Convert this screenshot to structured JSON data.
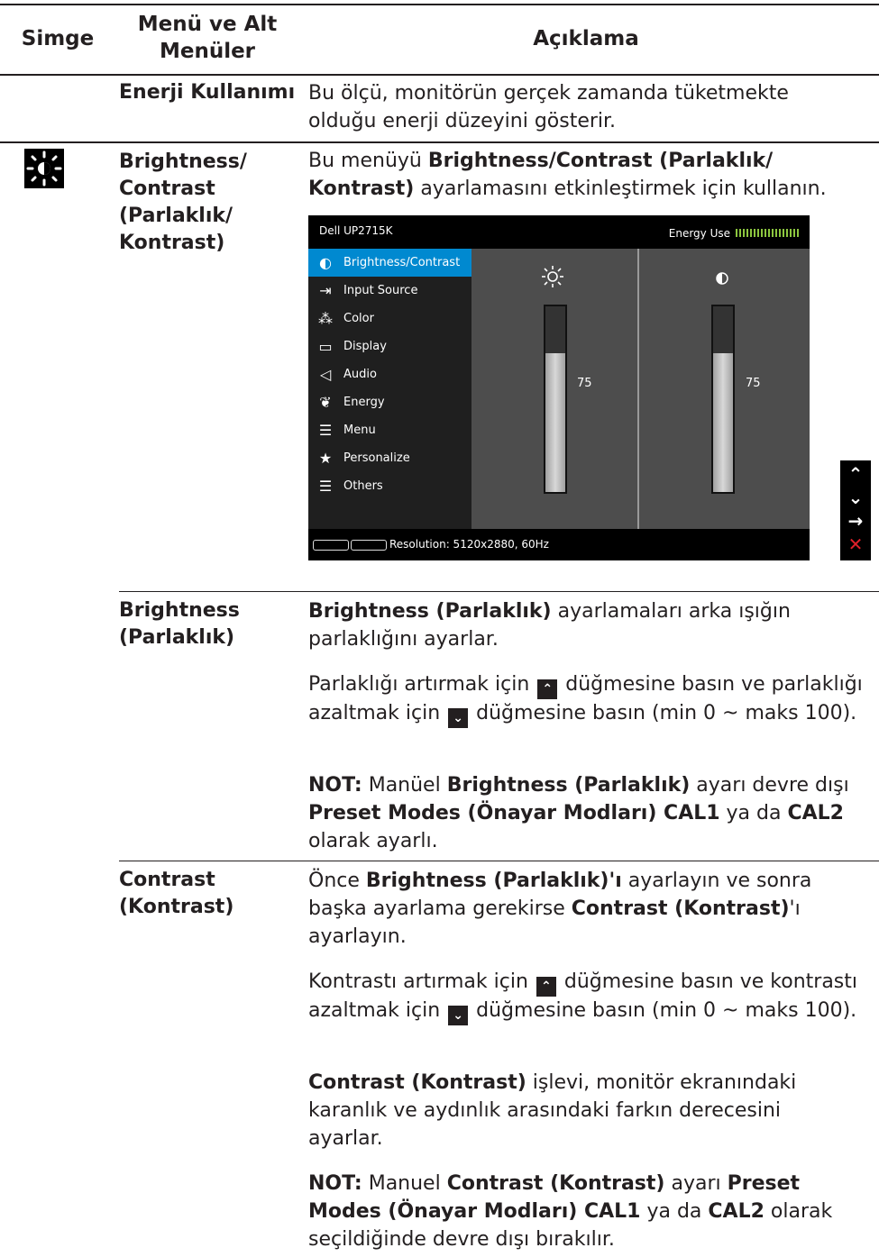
{
  "table": {
    "headers": {
      "icon": "Simge",
      "menu": "Menü ve Alt Menüler",
      "desc": "Açıklama"
    },
    "energy_row": {
      "term": "Enerji Kullanımı",
      "desc": "Bu ölçü, monitörün gerçek zamanda tüketmekte olduğu enerji düzeyini gösterir."
    },
    "bc_row": {
      "term": "Brightness/ Contrast (Parlaklık/ Kontrast)",
      "desc_pre": "Bu menüyü ",
      "desc_bold": "Brightness/Contrast (Parlaklık/ Kontrast)",
      "desc_post": " ayarlamasını etkinleştirmek için kullanın."
    },
    "brightness_row": {
      "term": "Brightness (Parlaklık)",
      "p1_bold": "Brightness (Parlaklık)",
      "p1_rest": " ayarlamaları arka ışığın parlaklığını ayarlar.",
      "p2_a": "Parlaklığı artırmak için ",
      "p2_b": " düğmesine basın ve parlaklığı azaltmak için ",
      "p2_c": " düğmesine basın (min 0 ~ maks 100).",
      "p3_note": "NOT:",
      "p3_a": " Manüel ",
      "p3_b": "Brightness (Parlaklık)",
      "p3_c": " ayarı devre dışı ",
      "p3_d": "Preset Modes (Önayar Modları) CAL1",
      "p3_e": " ya da ",
      "p3_f": "CAL2",
      "p3_g": " olarak ayarlı."
    },
    "contrast_row": {
      "term": "Contrast (Kontrast)",
      "p1_a": "Önce ",
      "p1_b": "Brightness (Parlaklık)'ı",
      "p1_c": " ayarlayın ve sonra başka ayarlama gerekirse ",
      "p1_d": "Contrast (Kontrast)",
      "p1_e": "'ı ayarlayın.",
      "p2_a": "Kontrastı artırmak için ",
      "p2_b": " düğmesine basın ve kontrastı azaltmak için ",
      "p2_c": " düğmesine basın (min 0 ~ maks 100).",
      "p3_b": "Contrast (Kontrast)",
      "p3_rest": " işlevi, monitör ekranındaki karanlık ve aydınlık arasındaki farkın derecesini ayarlar.",
      "p4_note": "NOT:",
      "p4_a": " Manuel ",
      "p4_b": "Contrast (Kontrast)",
      "p4_c": " ayarı ",
      "p4_d": "Preset Modes (Önayar Modları) CAL1",
      "p4_e": " ya da ",
      "p4_f": "CAL2",
      "p4_g": " olarak seçildiğinde devre dışı bırakılır."
    }
  },
  "osd": {
    "title": "Dell UP2715K",
    "energy_label": "Energy Use",
    "menu": [
      {
        "label": "Brightness/Contrast",
        "icon": "brightness-icon",
        "selected": true
      },
      {
        "label": "Input Source",
        "icon": "input-source-icon"
      },
      {
        "label": "Color",
        "icon": "color-icon"
      },
      {
        "label": "Display",
        "icon": "display-icon"
      },
      {
        "label": "Audio",
        "icon": "audio-icon"
      },
      {
        "label": "Energy",
        "icon": "energy-icon"
      },
      {
        "label": "Menu",
        "icon": "menu-icon"
      },
      {
        "label": "Personalize",
        "icon": "star-icon"
      },
      {
        "label": "Others",
        "icon": "others-icon"
      }
    ],
    "brightness_value": "75",
    "contrast_value": "75",
    "brightness_level": 75,
    "contrast_level": 75,
    "resolution": "Resolution: 5120x2880, 60Hz"
  },
  "nav_icons": [
    "up-arrow-icon",
    "down-arrow-icon",
    "right-arrow-icon",
    "close-icon"
  ],
  "colors": {
    "accent": "#0089d0",
    "energy": "#8cc63f",
    "exit": "#e0202a"
  }
}
